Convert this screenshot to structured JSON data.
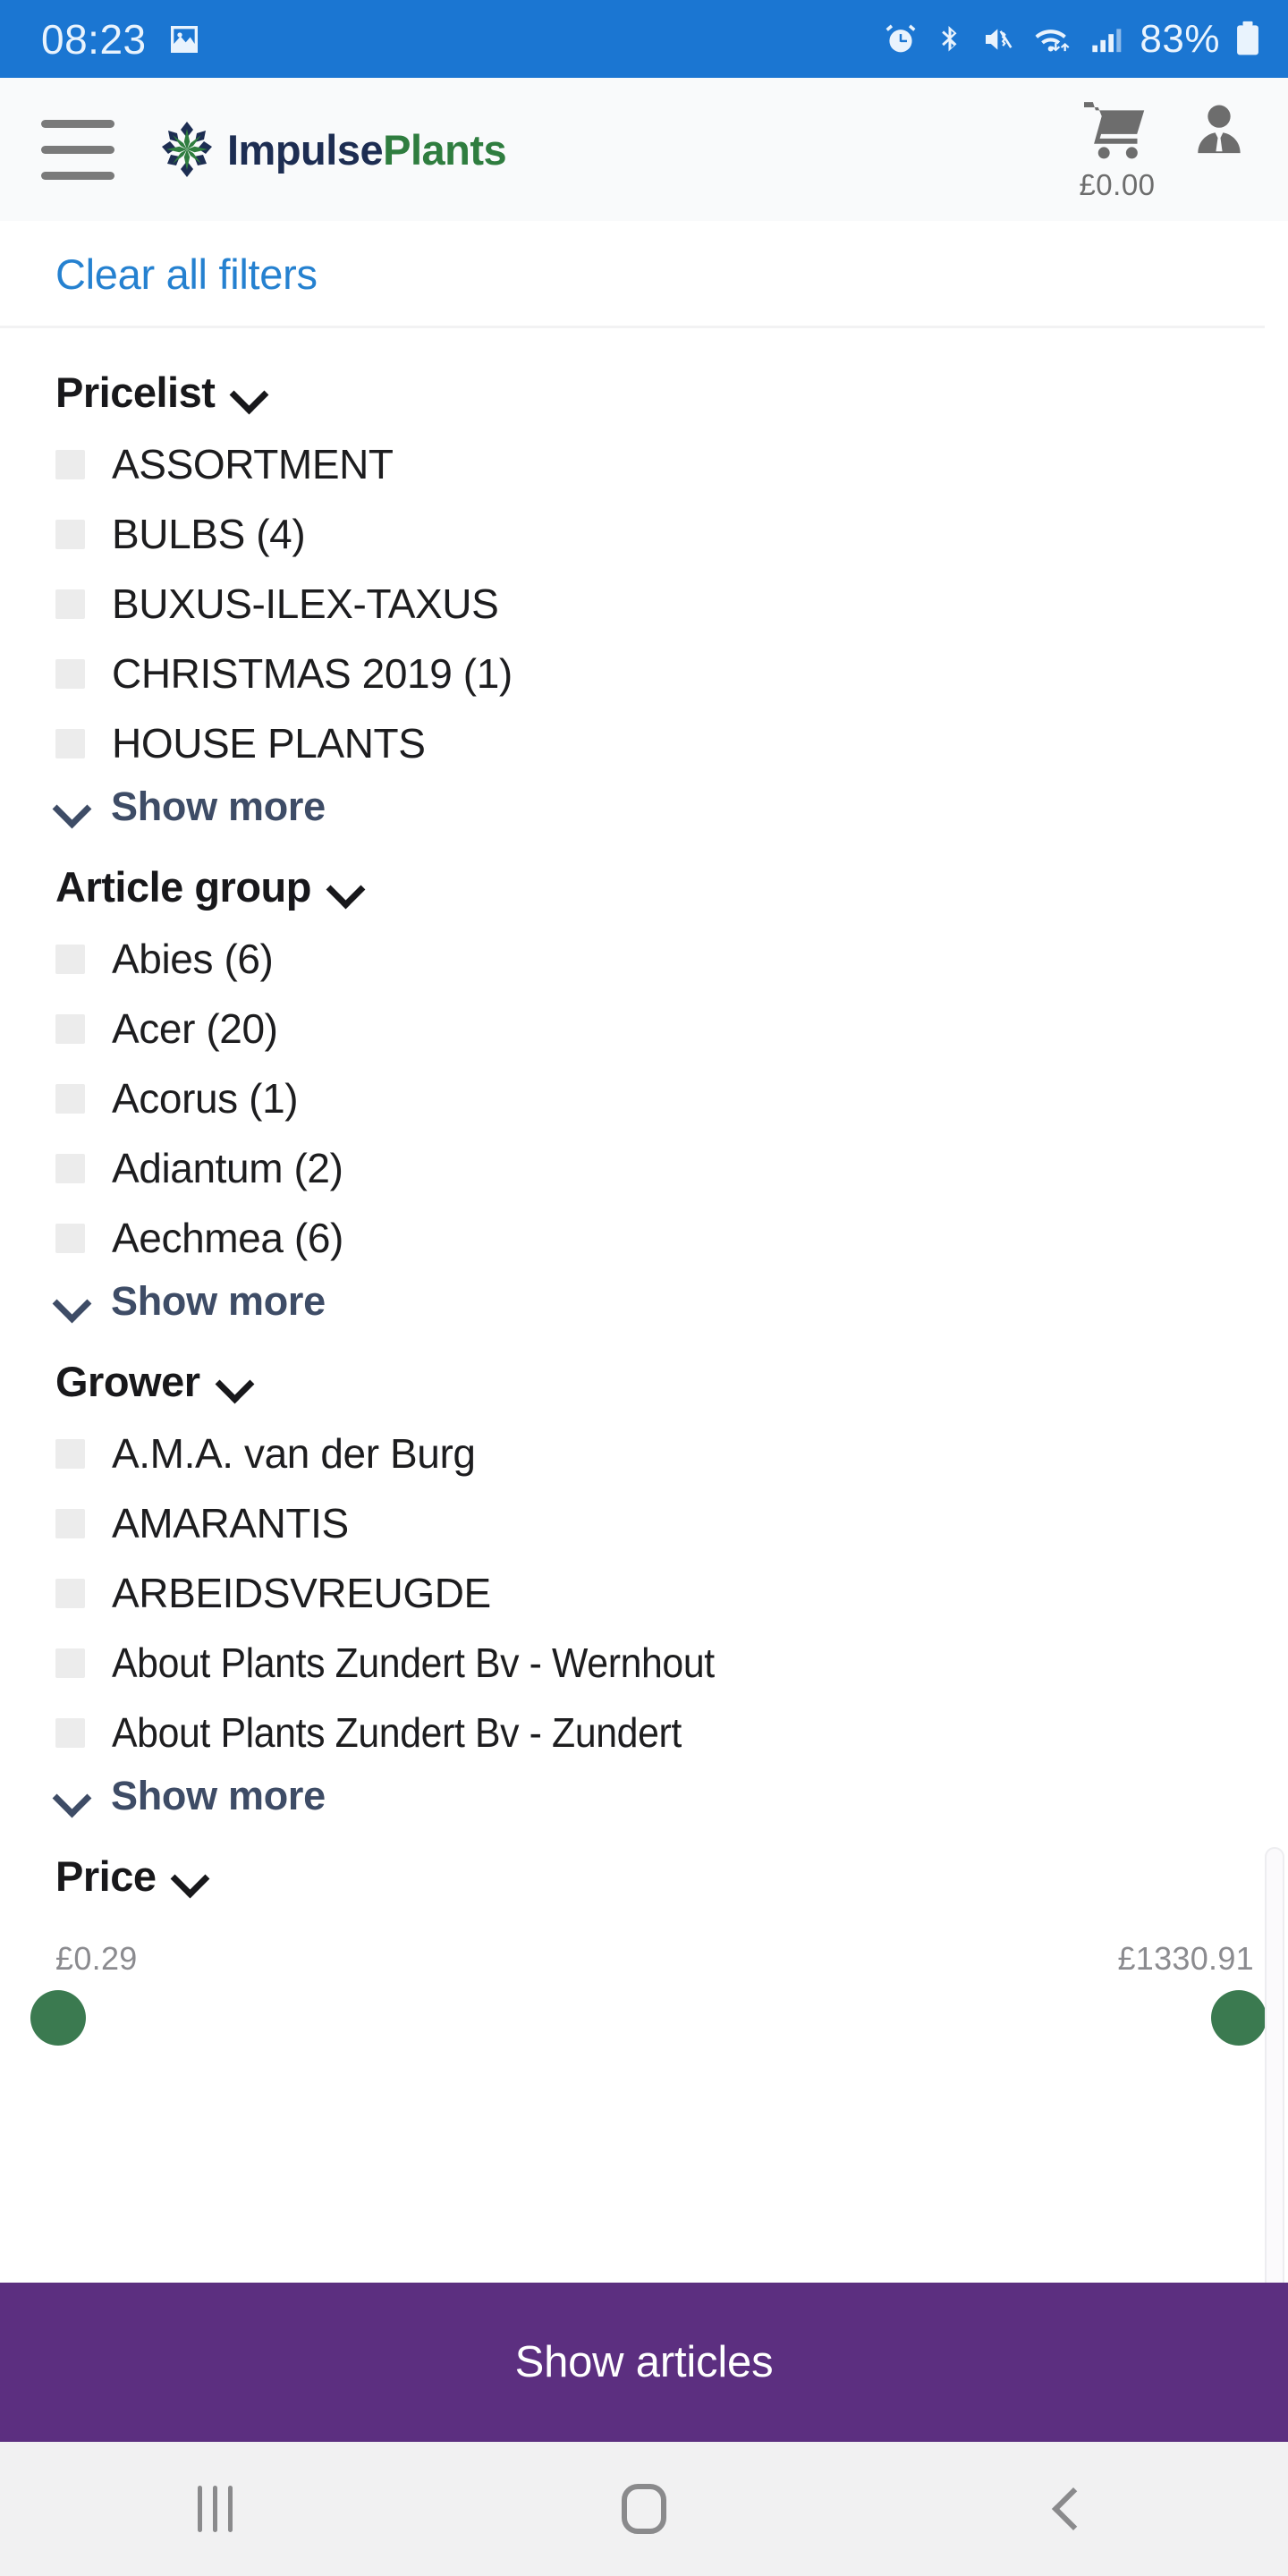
{
  "status_bar": {
    "time": "08:23",
    "battery_percent": "83%",
    "icons": [
      "image-icon",
      "alarm-icon",
      "bluetooth-icon",
      "mute-vibrate-icon",
      "wifi-icon",
      "signal-icon",
      "battery-icon"
    ],
    "background_color": "#1b76d2"
  },
  "header": {
    "menu_icon": "hamburger-icon",
    "brand_first": "Impulse",
    "brand_second": "Plants",
    "brand_first_color": "#1d2d52",
    "brand_second_color": "#2f7d3f",
    "cart_icon": "shopping-cart-icon",
    "cart_total": "£0.00",
    "account_icon": "user-account-icon"
  },
  "filters": {
    "clear_all_label": "Clear all filters",
    "clear_all_color": "#2581d0",
    "show_more_label": "Show more",
    "groups": [
      {
        "title": "Pricelist",
        "options": [
          {
            "label": "ASSORTMENT"
          },
          {
            "label": "BULBS (4)"
          },
          {
            "label": "BUXUS-ILEX-TAXUS"
          },
          {
            "label": "CHRISTMAS 2019 (1)"
          },
          {
            "label": "HOUSE PLANTS"
          }
        ]
      },
      {
        "title": "Article group",
        "options": [
          {
            "label": "Abies (6)"
          },
          {
            "label": "Acer (20)"
          },
          {
            "label": "Acorus (1)"
          },
          {
            "label": "Adiantum (2)"
          },
          {
            "label": "Aechmea (6)"
          }
        ]
      },
      {
        "title": "Grower",
        "options": [
          {
            "label": "A.M.A. van der Burg"
          },
          {
            "label": "AMARANTIS"
          },
          {
            "label": "ARBEIDSVREUGDE"
          },
          {
            "label": "About Plants Zundert Bv - Wernhout"
          },
          {
            "label": "About Plants Zundert Bv - Zundert"
          }
        ]
      }
    ],
    "price": {
      "title": "Price",
      "min_value": "£0.29",
      "max_value": "£1330.91",
      "handle_color": "#3b7a50"
    }
  },
  "cta": {
    "label": "Show articles",
    "background_color": "#5c2f80"
  },
  "nav_bar": {
    "recents_icon": "recents-icon",
    "home_icon": "home-icon",
    "back_icon": "back-icon"
  }
}
